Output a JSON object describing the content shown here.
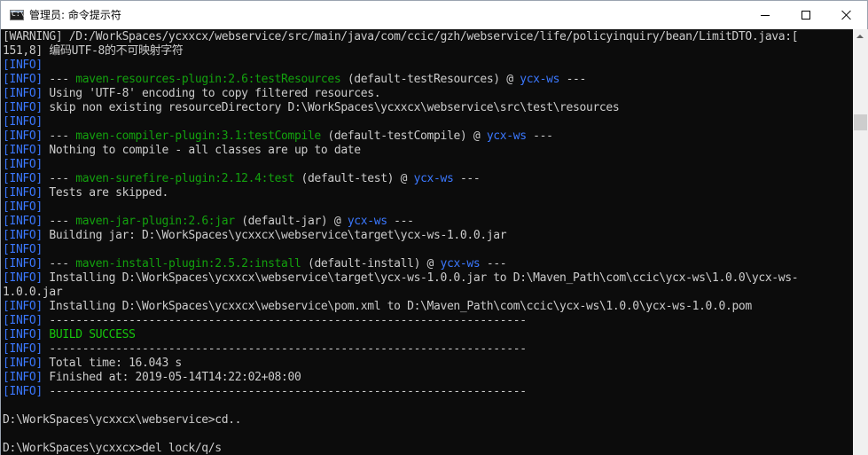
{
  "window": {
    "title": "管理员: 命令提示符",
    "app_icon_glyph": "C:\\"
  },
  "console": {
    "lines": [
      [
        {
          "t": "[WARNING] /D:/WorkSpaces/ycxxcx/webservice/src/main/java/com/ccic/gzh/webservice/life/policyinquiry/bean/LimitDTO.java:[",
          "c": ""
        }
      ],
      [
        {
          "t": "151,8] 编码UTF-8的不可映射字符",
          "c": ""
        }
      ],
      [
        {
          "t": "[INFO]",
          "c": "tag"
        }
      ],
      [
        {
          "t": "[INFO]",
          "c": "tag"
        },
        {
          "t": " --- ",
          "c": ""
        },
        {
          "t": "maven-resources-plugin:2.6:testResources",
          "c": "plugin"
        },
        {
          "t": " (default-testResources) @ ",
          "c": ""
        },
        {
          "t": "ycx-ws",
          "c": "proj"
        },
        {
          "t": " ---",
          "c": ""
        }
      ],
      [
        {
          "t": "[INFO]",
          "c": "tag"
        },
        {
          "t": " Using 'UTF-8' encoding to copy filtered resources.",
          "c": ""
        }
      ],
      [
        {
          "t": "[INFO]",
          "c": "tag"
        },
        {
          "t": " skip non existing resourceDirectory D:\\WorkSpaces\\ycxxcx\\webservice\\src\\test\\resources",
          "c": ""
        }
      ],
      [
        {
          "t": "[INFO]",
          "c": "tag"
        }
      ],
      [
        {
          "t": "[INFO]",
          "c": "tag"
        },
        {
          "t": " --- ",
          "c": ""
        },
        {
          "t": "maven-compiler-plugin:3.1:testCompile",
          "c": "plugin"
        },
        {
          "t": " (default-testCompile) @ ",
          "c": ""
        },
        {
          "t": "ycx-ws",
          "c": "proj"
        },
        {
          "t": " ---",
          "c": ""
        }
      ],
      [
        {
          "t": "[INFO]",
          "c": "tag"
        },
        {
          "t": " Nothing to compile - all classes are up to date",
          "c": ""
        }
      ],
      [
        {
          "t": "[INFO]",
          "c": "tag"
        }
      ],
      [
        {
          "t": "[INFO]",
          "c": "tag"
        },
        {
          "t": " --- ",
          "c": ""
        },
        {
          "t": "maven-surefire-plugin:2.12.4:test",
          "c": "plugin"
        },
        {
          "t": " (default-test) @ ",
          "c": ""
        },
        {
          "t": "ycx-ws",
          "c": "proj"
        },
        {
          "t": " ---",
          "c": ""
        }
      ],
      [
        {
          "t": "[INFO]",
          "c": "tag"
        },
        {
          "t": " Tests are skipped.",
          "c": ""
        }
      ],
      [
        {
          "t": "[INFO]",
          "c": "tag"
        }
      ],
      [
        {
          "t": "[INFO]",
          "c": "tag"
        },
        {
          "t": " --- ",
          "c": ""
        },
        {
          "t": "maven-jar-plugin:2.6:jar",
          "c": "plugin"
        },
        {
          "t": " (default-jar) @ ",
          "c": ""
        },
        {
          "t": "ycx-ws",
          "c": "proj"
        },
        {
          "t": " ---",
          "c": ""
        }
      ],
      [
        {
          "t": "[INFO]",
          "c": "tag"
        },
        {
          "t": " Building jar: D:\\WorkSpaces\\ycxxcx\\webservice\\target\\ycx-ws-1.0.0.jar",
          "c": ""
        }
      ],
      [
        {
          "t": "[INFO]",
          "c": "tag"
        }
      ],
      [
        {
          "t": "[INFO]",
          "c": "tag"
        },
        {
          "t": " --- ",
          "c": ""
        },
        {
          "t": "maven-install-plugin:2.5.2:install",
          "c": "plugin"
        },
        {
          "t": " (default-install) @ ",
          "c": ""
        },
        {
          "t": "ycx-ws",
          "c": "proj"
        },
        {
          "t": " ---",
          "c": ""
        }
      ],
      [
        {
          "t": "[INFO]",
          "c": "tag"
        },
        {
          "t": " Installing D:\\WorkSpaces\\ycxxcx\\webservice\\target\\ycx-ws-1.0.0.jar to D:\\Maven_Path\\com\\ccic\\ycx-ws\\1.0.0\\ycx-ws-",
          "c": ""
        }
      ],
      [
        {
          "t": "1.0.0.jar",
          "c": ""
        }
      ],
      [
        {
          "t": "[INFO]",
          "c": "tag"
        },
        {
          "t": " Installing D:\\WorkSpaces\\ycxxcx\\webservice\\pom.xml to D:\\Maven_Path\\com\\ccic\\ycx-ws\\1.0.0\\ycx-ws-1.0.0.pom",
          "c": ""
        }
      ],
      [
        {
          "t": "[INFO]",
          "c": "tag"
        },
        {
          "t": " ------------------------------------------------------------------------",
          "c": ""
        }
      ],
      [
        {
          "t": "[INFO]",
          "c": "tag"
        },
        {
          "t": " ",
          "c": ""
        },
        {
          "t": "BUILD SUCCESS",
          "c": "ok"
        }
      ],
      [
        {
          "t": "[INFO]",
          "c": "tag"
        },
        {
          "t": " ------------------------------------------------------------------------",
          "c": ""
        }
      ],
      [
        {
          "t": "[INFO]",
          "c": "tag"
        },
        {
          "t": " Total time: 16.043 s",
          "c": ""
        }
      ],
      [
        {
          "t": "[INFO]",
          "c": "tag"
        },
        {
          "t": " Finished at: 2019-05-14T14:22:02+08:00",
          "c": ""
        }
      ],
      [
        {
          "t": "[INFO]",
          "c": "tag"
        },
        {
          "t": " ------------------------------------------------------------------------",
          "c": ""
        }
      ],
      [
        {
          "t": "",
          "c": ""
        }
      ],
      [
        {
          "t": "D:\\WorkSpaces\\ycxxcx\\webservice>cd..",
          "c": ""
        }
      ],
      [
        {
          "t": "",
          "c": ""
        }
      ],
      [
        {
          "t": "D:\\WorkSpaces\\ycxxcx>del lock/q/s",
          "c": ""
        }
      ]
    ]
  },
  "colors": {
    "background": "#0c0c0c",
    "text": "#cccccc",
    "info_tag": "#3b78ff",
    "plugin": "#13a10e",
    "project": "#3b78ff",
    "success": "#16c60c"
  },
  "icons": {
    "app": "cmd-app-icon",
    "minimize": "minimize-icon",
    "maximize": "maximize-icon",
    "close": "close-icon",
    "scroll_up": "chevron-up-icon"
  }
}
